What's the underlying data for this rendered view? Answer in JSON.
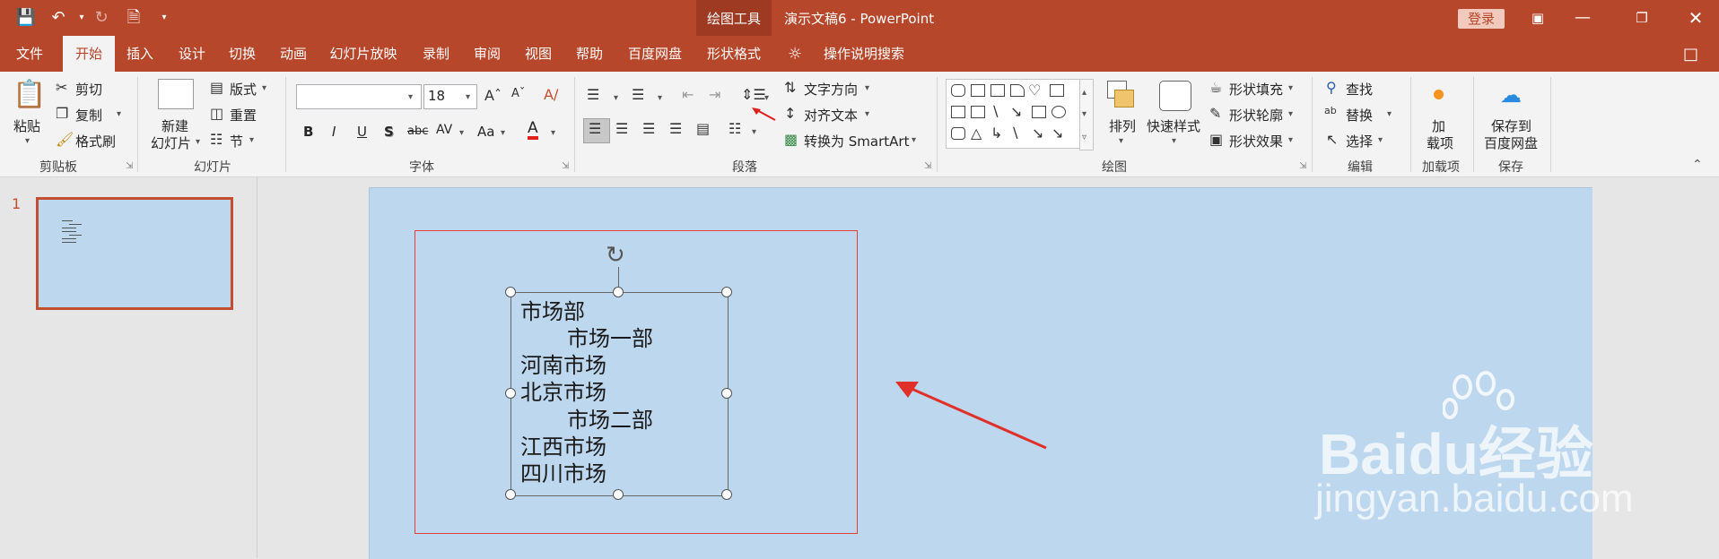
{
  "app": {
    "context_tab_group": "绘图工具",
    "doc_title": "演示文稿6  -  PowerPoint",
    "login": "登录"
  },
  "tabs": [
    "文件",
    "开始",
    "插入",
    "设计",
    "切换",
    "动画",
    "幻灯片放映",
    "录制",
    "审阅",
    "视图",
    "帮助",
    "百度网盘",
    "形状格式"
  ],
  "search_label": "操作说明搜索",
  "ribbon": {
    "clipboard": {
      "paste": "粘贴",
      "cut": "剪切",
      "copy": "复制",
      "format_painter": "格式刷",
      "label": "剪贴板"
    },
    "slides": {
      "new_slide_1": "新建",
      "new_slide_2": "幻灯片",
      "layout": "版式",
      "reset": "重置",
      "section": "节",
      "label": "幻灯片"
    },
    "font": {
      "size": "18",
      "bold": "B",
      "italic": "I",
      "underline": "U",
      "shadow": "S",
      "strike": "abc",
      "spacing": "AV",
      "case": "Aa",
      "color": "A",
      "label": "字体"
    },
    "paragraph": {
      "text_direction": "文字方向",
      "align_text": "对齐文本",
      "smartart": "转换为 SmartArt",
      "label": "段落"
    },
    "drawing": {
      "arrange": "排列",
      "quick_styles": "快速样式",
      "fill": "形状填充",
      "outline": "形状轮廓",
      "effects": "形状效果",
      "label": "绘图"
    },
    "editing": {
      "find": "查找",
      "replace": "替换",
      "select": "选择",
      "label": "编辑"
    },
    "addins": {
      "addin_1": "加",
      "addin_2": "载项",
      "label": "加载项"
    },
    "save": {
      "save_1": "保存到",
      "save_2": "百度网盘",
      "label": "保存"
    }
  },
  "slides_pane": {
    "number": "1"
  },
  "textbox_lines": [
    "市场部",
    "市场一部",
    "河南市场",
    "北京市场",
    "市场二部",
    "江西市场",
    "四川市场"
  ],
  "watermark": {
    "logo": "Baidu经验",
    "url": "jingyan.baidu.com"
  },
  "colors": {
    "accent": "#b7472a",
    "slide_bg": "#bdd7ee",
    "frame": "#e0403a"
  }
}
